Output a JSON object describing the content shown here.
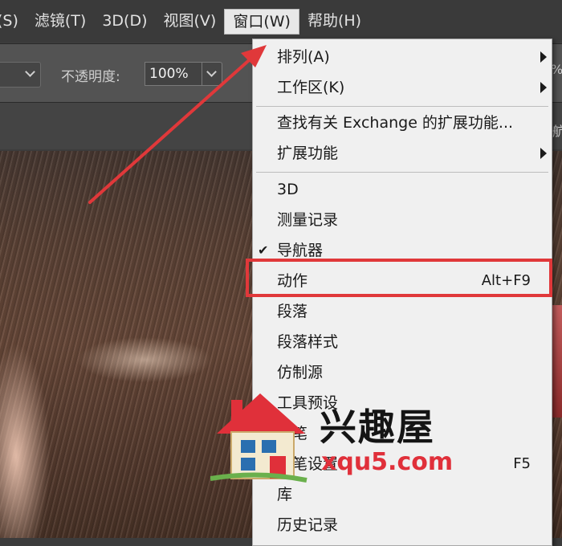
{
  "menubar": {
    "items": [
      {
        "label": "(S)"
      },
      {
        "label": "滤镜(T)"
      },
      {
        "label": "3D(D)"
      },
      {
        "label": "视图(V)"
      },
      {
        "label": "窗口(W)"
      },
      {
        "label": "帮助(H)"
      }
    ]
  },
  "options": {
    "opacity_label": "不透明度:",
    "opacity_value": "100%",
    "right_fragment": "%"
  },
  "tabstrip": {
    "right_fragment": "航"
  },
  "window_menu": {
    "items": [
      {
        "label": "排列(A)"
      },
      {
        "label": "工作区(K)"
      },
      {
        "label": "查找有关 Exchange 的扩展功能..."
      },
      {
        "label": "扩展功能"
      },
      {
        "label": "3D"
      },
      {
        "label": "测量记录"
      },
      {
        "label": "导航器"
      },
      {
        "label": "动作",
        "shortcut": "Alt+F9"
      },
      {
        "label": "段落"
      },
      {
        "label": "段落样式"
      },
      {
        "label": "仿制源"
      },
      {
        "label": "工具预设"
      },
      {
        "label": "画笔"
      },
      {
        "label": "画笔设置",
        "shortcut": "F5"
      },
      {
        "label": "库"
      },
      {
        "label": "历史记录"
      }
    ],
    "checked_glyph": "✔"
  },
  "watermark": {
    "brand": "兴趣屋",
    "domain": "xqu5.com"
  },
  "colors": {
    "highlight": "#e0383a",
    "arrow": "#e0383a",
    "menu_bg": "#f0f0f0"
  }
}
